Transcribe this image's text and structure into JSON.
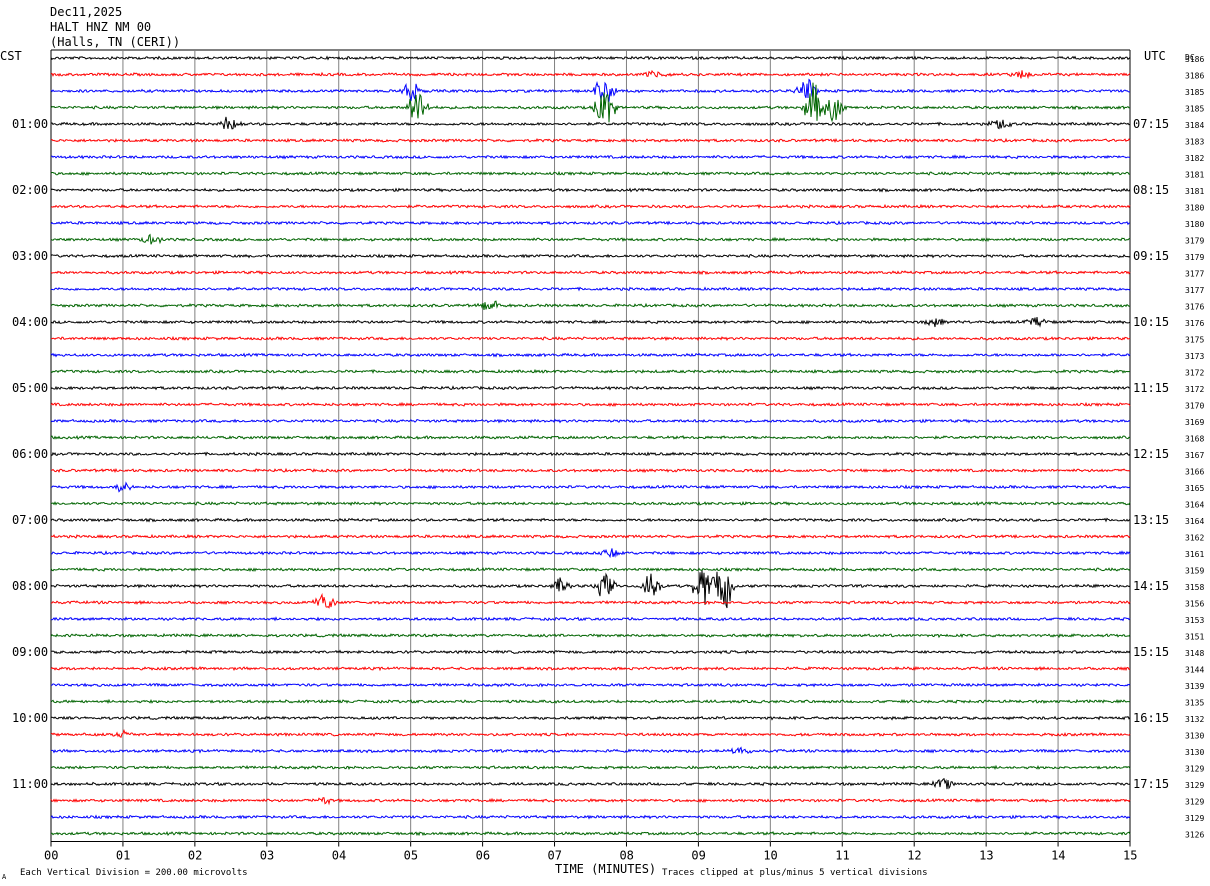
{
  "header": {
    "date": "Dec11,2025",
    "station": "HALT HNZ NM 00",
    "location": "(Halls, TN (CERI))"
  },
  "left_tz": "CST",
  "right_tz": "UTC",
  "dc_label": "DC",
  "footer": {
    "left": "Each Vertical Division =  200.00 microvolts",
    "right": "Traces clipped at plus/minus 5 vertical divisions",
    "corner": "A"
  },
  "colors": {
    "black": "#000000",
    "red": "#ff0000",
    "blue": "#0000ff",
    "green": "#006400",
    "grid": "#808080"
  },
  "chart_data": {
    "type": "line",
    "title": "HALT HNZ NM 00",
    "xlabel": "TIME (MINUTES)",
    "xlim": [
      0,
      15
    ],
    "x_ticks": [
      "00",
      "01",
      "02",
      "03",
      "04",
      "05",
      "06",
      "07",
      "08",
      "09",
      "10",
      "11",
      "12",
      "13",
      "14",
      "15"
    ],
    "left_labels": [
      "01:00",
      "02:00",
      "03:00",
      "04:00",
      "05:00",
      "06:00",
      "07:00",
      "08:00",
      "09:00",
      "10:00",
      "11:00"
    ],
    "right_labels": [
      "07:15",
      "08:15",
      "09:15",
      "10:15",
      "11:15",
      "12:15",
      "13:15",
      "14:15",
      "15:15",
      "16:15",
      "17:15"
    ],
    "trace_colors": [
      "black",
      "red",
      "blue",
      "green"
    ],
    "dc_values": [
      "3186",
      "3186",
      "3185",
      "3185",
      "3184",
      "3183",
      "3182",
      "3181",
      "3181",
      "3180",
      "3180",
      "3179",
      "3179",
      "3177",
      "3177",
      "3176",
      "3176",
      "3175",
      "3173",
      "3172",
      "3172",
      "3170",
      "3169",
      "3168",
      "3167",
      "3166",
      "3165",
      "3164",
      "3164",
      "3162",
      "3161",
      "3159",
      "3158",
      "3156",
      "3153",
      "3151",
      "3148",
      "3144",
      "3139",
      "3135",
      "3132",
      "3130",
      "3130",
      "3129",
      "3129",
      "3129",
      "3129",
      "3126"
    ],
    "events": [
      {
        "trace": 1,
        "x": 8.4,
        "amp": 0.3
      },
      {
        "trace": 1,
        "x": 13.5,
        "amp": 0.3
      },
      {
        "trace": 2,
        "x": 5.0,
        "amp": 1.0
      },
      {
        "trace": 2,
        "x": 7.7,
        "amp": 1.2
      },
      {
        "trace": 2,
        "x": 10.5,
        "amp": 1.0
      },
      {
        "trace": 3,
        "x": 5.1,
        "amp": 1.6
      },
      {
        "trace": 3,
        "x": 7.7,
        "amp": 2.0
      },
      {
        "trace": 3,
        "x": 10.6,
        "amp": 1.8
      },
      {
        "trace": 3,
        "x": 10.9,
        "amp": 1.0
      },
      {
        "trace": 4,
        "x": 2.5,
        "amp": 0.6
      },
      {
        "trace": 4,
        "x": 13.2,
        "amp": 0.4
      },
      {
        "trace": 11,
        "x": 1.4,
        "amp": 0.5
      },
      {
        "trace": 15,
        "x": 6.1,
        "amp": 0.5
      },
      {
        "trace": 16,
        "x": 12.3,
        "amp": 0.3
      },
      {
        "trace": 16,
        "x": 13.7,
        "amp": 0.3
      },
      {
        "trace": 26,
        "x": 1.0,
        "amp": 0.3
      },
      {
        "trace": 30,
        "x": 7.8,
        "amp": 0.3
      },
      {
        "trace": 32,
        "x": 7.1,
        "amp": 0.6
      },
      {
        "trace": 32,
        "x": 7.7,
        "amp": 0.9
      },
      {
        "trace": 32,
        "x": 8.35,
        "amp": 1.2
      },
      {
        "trace": 32,
        "x": 9.05,
        "amp": 1.6
      },
      {
        "trace": 32,
        "x": 9.35,
        "amp": 1.8
      },
      {
        "trace": 33,
        "x": 3.8,
        "amp": 0.8
      },
      {
        "trace": 41,
        "x": 1.0,
        "amp": 0.2
      },
      {
        "trace": 42,
        "x": 9.6,
        "amp": 0.3
      },
      {
        "trace": 44,
        "x": 12.4,
        "amp": 0.4
      },
      {
        "trace": 45,
        "x": 3.8,
        "amp": 0.2
      }
    ]
  }
}
